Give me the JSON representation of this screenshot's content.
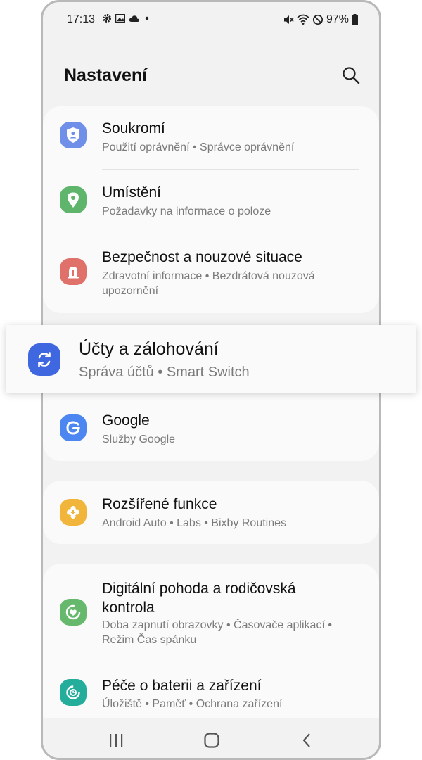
{
  "status_bar": {
    "time": "17:13",
    "battery": "97%",
    "left_icons": [
      "gear-icon",
      "image-icon",
      "cloud-icon",
      "dot-icon"
    ],
    "right_icons": [
      "mute-icon",
      "wifi-icon",
      "dnd-icon",
      "battery-icon"
    ]
  },
  "header": {
    "title": "Nastavení",
    "search_icon": "search-icon"
  },
  "items": [
    {
      "title": "Soukromí",
      "subtitle": "Použití oprávnění  •  Správce oprávnění",
      "icon": "shield-user-icon",
      "color": "#6f8fe8"
    },
    {
      "title": "Umístění",
      "subtitle": "Požadavky na informace o poloze",
      "icon": "location-pin-icon",
      "color": "#5fb56b"
    },
    {
      "title": "Bezpečnost a nouzové situace",
      "subtitle": "Zdravotní informace  •  Bezdrátová nouzová upozornění",
      "icon": "warning-icon",
      "color": "#e0716a"
    },
    {
      "title": "Google",
      "subtitle": "Služby Google",
      "icon": "google-icon",
      "color": "#4c86f0"
    },
    {
      "title": "Rozšířené funkce",
      "subtitle": "Android Auto  •  Labs  •  Bixby Routines",
      "icon": "puzzle-plus-icon",
      "color": "#f2b53c"
    },
    {
      "title": "Digitální pohoda a rodičovská kontrola",
      "subtitle": "Doba zapnutí obrazovky  •  Časovače aplikací  •  Režim Čas spánku",
      "icon": "wellbeing-heart-icon",
      "color": "#66b96c"
    },
    {
      "title": "Péče o baterii a zařízení",
      "subtitle": "Úložiště  •  Paměť  •  Ochrana zařízení",
      "icon": "device-care-icon",
      "color": "#23ad9a"
    }
  ],
  "highlight": {
    "title": "Účty a zálohování",
    "subtitle": "Správa účtů  •  Smart Switch",
    "icon": "sync-icon",
    "color": "#3e67e0"
  },
  "navbar": {
    "recent_icon": "recent-apps-icon",
    "home_icon": "home-icon",
    "back_icon": "back-icon"
  }
}
